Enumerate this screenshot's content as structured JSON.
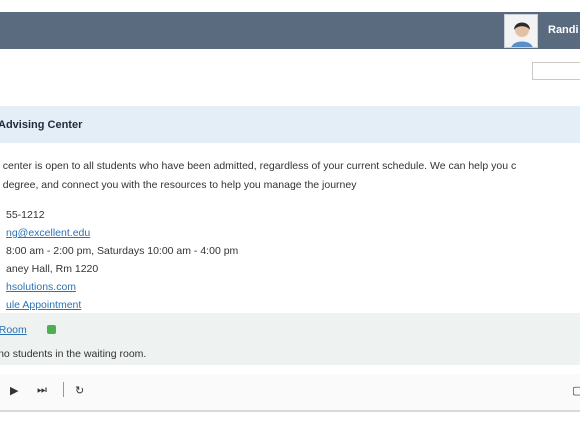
{
  "header": {
    "user_name": "Randi"
  },
  "panel": {
    "title": "Advising Center",
    "description_line1": "g center is open to all students who have been admitted, regardless of your current schedule. We can help you c",
    "description_line2": "d degree, and connect you with the resources to help you manage the journey"
  },
  "contact": {
    "phone": "55-1212",
    "email": "ng@excellent.edu",
    "hours": "8:00 am - 2:00 pm, Saturdays 10:00 am - 4:00 pm",
    "location": "aney Hall, Rm 1220",
    "website": "hsolutions.com",
    "appointment": "ule Appointment"
  },
  "waiting": {
    "link_label": "g Room",
    "message": "are no students in the waiting room."
  },
  "controls": {
    "play_icon": "▶",
    "skip_icon": "⏭",
    "refresh_icon": "↻"
  }
}
